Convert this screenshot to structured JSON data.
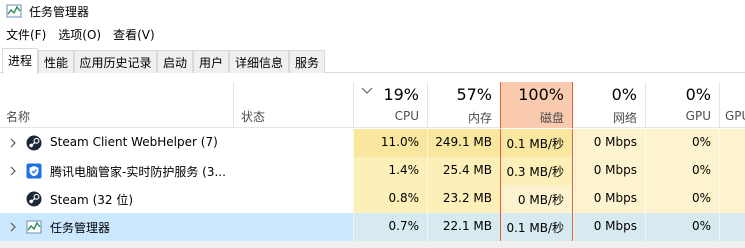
{
  "window": {
    "title": "任务管理器"
  },
  "menu": [
    "文件(F)",
    "选项(O)",
    "查看(V)"
  ],
  "tabs": [
    {
      "label": "进程",
      "active": true
    },
    {
      "label": "性能",
      "active": false
    },
    {
      "label": "应用历史记录",
      "active": false
    },
    {
      "label": "启动",
      "active": false
    },
    {
      "label": "用户",
      "active": false
    },
    {
      "label": "详细信息",
      "active": false
    },
    {
      "label": "服务",
      "active": false
    }
  ],
  "columns": {
    "name": "名称",
    "status": "状态",
    "cpu": {
      "percent": "19%",
      "label": "CPU"
    },
    "memory": {
      "percent": "57%",
      "label": "内存"
    },
    "disk": {
      "percent": "100%",
      "label": "磁盘"
    },
    "network": {
      "percent": "0%",
      "label": "网络"
    },
    "gpu": {
      "percent": "0%",
      "label": "GPU"
    },
    "gpu_engine": {
      "label": "GPU"
    }
  },
  "processes": [
    {
      "name": "Steam Client WebHelper (7)",
      "icon": "steam-icon",
      "expandable": true,
      "cpu": "11.0%",
      "memory": "249.1 MB",
      "disk": "0.1 MB/秒",
      "network": "0 Mbps",
      "gpu": "0%"
    },
    {
      "name": "腾讯电脑管家-实时防护服务 (3...",
      "icon": "tencent-shield-icon",
      "expandable": true,
      "cpu": "1.4%",
      "memory": "25.4 MB",
      "disk": "0.3 MB/秒",
      "network": "0 Mbps",
      "gpu": "0%"
    },
    {
      "name": "Steam (32 位)",
      "icon": "steam-icon",
      "expandable": false,
      "cpu": "0.8%",
      "memory": "23.2 MB",
      "disk": "0 MB/秒",
      "network": "0 Mbps",
      "gpu": "0%"
    },
    {
      "name": "任务管理器",
      "icon": "task-manager-icon",
      "expandable": true,
      "selected": true,
      "cpu": "0.7%",
      "memory": "22.1 MB",
      "disk": "0.1 MB/秒",
      "network": "0 Mbps",
      "gpu": "0%"
    }
  ],
  "colors": {
    "heat_high": "#f9e79f",
    "heat_mid": "#fcefb8",
    "heat_low": "#fdf4cf",
    "disk_header": "#fbcbb0",
    "disk_border": "#e35f3b",
    "selected_row": "#cce8ff"
  }
}
